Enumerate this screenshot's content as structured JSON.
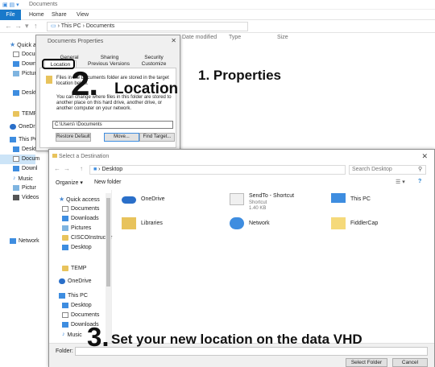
{
  "explorer": {
    "title": "Documents",
    "ribbon_tabs": [
      "File",
      "Home",
      "Share",
      "View"
    ],
    "breadcrumb": [
      "This PC",
      "Documents"
    ],
    "columns": [
      "Date modified",
      "Type",
      "Size"
    ],
    "tree": [
      "Quick a",
      "Docum",
      "Downl",
      "Pictur",
      "Deskto",
      "TEMP",
      "OneDri",
      "This PC",
      "Deskt",
      "Docum",
      "Downl",
      "Music",
      "Pictur",
      "Videos",
      "Network"
    ]
  },
  "properties": {
    "title": "Documents Properties",
    "close": "✕",
    "tabs_top": [
      "General",
      "Sharing",
      "Security"
    ],
    "tabs_bottom": [
      "Location",
      "Previous Versions",
      "Customize"
    ],
    "desc1": "Files in the Documents folder are stored in the target location below.",
    "desc2": "You can change where files in this folder are stored to another place on this hard drive, another drive, or another computer on your network.",
    "path_value": "C:\\Users\\         \\Documents",
    "buttons": [
      "Restore Default",
      "Move...",
      "Find Target..."
    ]
  },
  "annotations": {
    "step1": "1. Properties",
    "step2_num": "2.",
    "step2_text": "Location",
    "step3_num": "3.",
    "step3_text": "Set your new location on the data VHD"
  },
  "dialog": {
    "title": "Select a Destination",
    "close": "✕",
    "address": "Desktop",
    "search_placeholder": "Search Desktop",
    "organize": "Organize ▾",
    "new_folder": "New folder",
    "nav": [
      "Quick access",
      "Documents",
      "Downloads",
      "Pictures",
      "CISCOInstructor",
      "Desktop",
      "TEMP",
      "OneDrive",
      "This PC",
      "Desktop",
      "Documents",
      "Downloads",
      "Music"
    ],
    "items": [
      {
        "label": "OneDrive",
        "sub": ""
      },
      {
        "label": "SendTo - Shortcut",
        "sub": "Shortcut",
        "sub2": "1.40 KB"
      },
      {
        "label": "This PC",
        "sub": ""
      },
      {
        "label": "Libraries",
        "sub": ""
      },
      {
        "label": "Network",
        "sub": ""
      },
      {
        "label": "FiddlerCap",
        "sub": ""
      }
    ],
    "folder_label": "Folder:",
    "select_button": "Select Folder",
    "cancel_button": "Cancel"
  }
}
